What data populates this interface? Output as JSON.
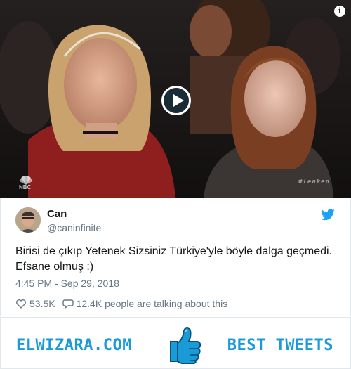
{
  "media": {
    "broadcaster_logo_text": "NBC",
    "watermark_text": "#lenken",
    "info_label": "i"
  },
  "tweet": {
    "author_name": "Can",
    "author_handle": "@caninfinite",
    "text": "Birisi de çıkıp Yetenek Sizsiniz Türkiye'yle böyle dalga geçmedi. Efsane olmuş :)",
    "timestamp": "4:45 PM - Sep 29, 2018",
    "likes": "53.5K",
    "replies_text": "12.4K people are talking about this"
  },
  "banner": {
    "left_text": "ELWIZARA.COM",
    "right_text": "BEST TWEETS"
  },
  "colors": {
    "twitter_blue": "#1da1f2",
    "banner_blue": "#1a9ad6",
    "secondary_text": "#657786"
  }
}
